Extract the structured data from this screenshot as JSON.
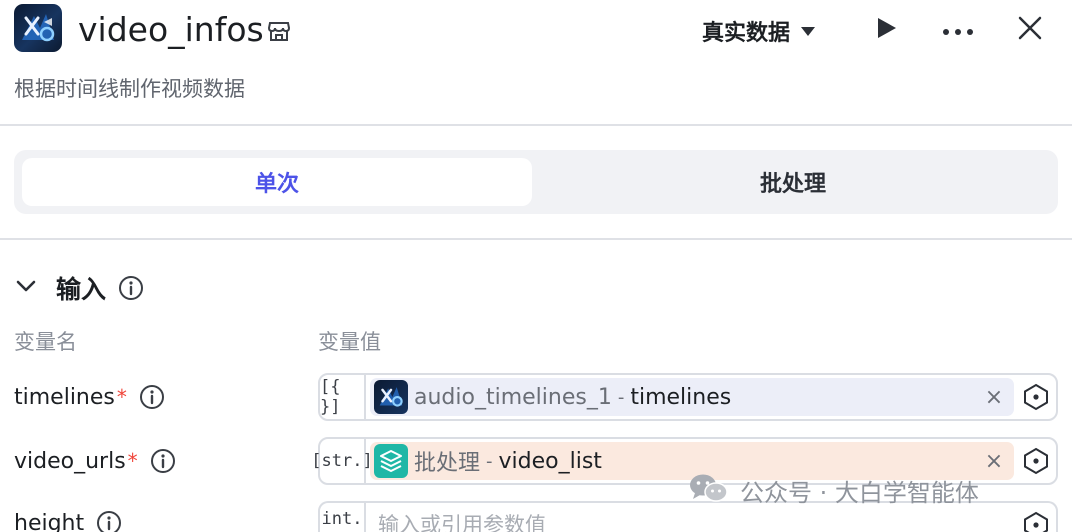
{
  "header": {
    "title": "video_infos",
    "mode_label": "真实数据",
    "icons": {
      "logo": "app-logo-icon",
      "store": "store-icon",
      "dropdown": "caret-down-icon",
      "run": "play-icon",
      "more": "more-icon",
      "close": "close-icon"
    }
  },
  "subtitle": "根据时间线制作视频数据",
  "tabs": [
    {
      "label": "单次",
      "active": true
    },
    {
      "label": "批处理",
      "active": false
    }
  ],
  "section": {
    "title": "输入",
    "columns": {
      "name": "变量名",
      "value": "变量值"
    }
  },
  "inputs": [
    {
      "name": "timelines",
      "required": "*",
      "type_tag": "[{ }]",
      "ref_source": "audio_timelines_1",
      "ref_sep": "-",
      "ref_var": "timelines",
      "clear": "×"
    },
    {
      "name": "video_urls",
      "required": "*",
      "type_tag": "[str.]",
      "ref_source": "批处理",
      "ref_sep": "-",
      "ref_var": "video_list",
      "clear": "×"
    },
    {
      "name": "height",
      "type_tag": "int.",
      "placeholder": "输入或引用参数值"
    }
  ],
  "watermark": "公众号 · 大白学智能体",
  "colors": {
    "accent": "#4d53e8",
    "required": "#f0453a",
    "chip_blue": "#eceef8",
    "chip_orange": "#fbe9df",
    "batch_icon": "#1fb7a6"
  }
}
